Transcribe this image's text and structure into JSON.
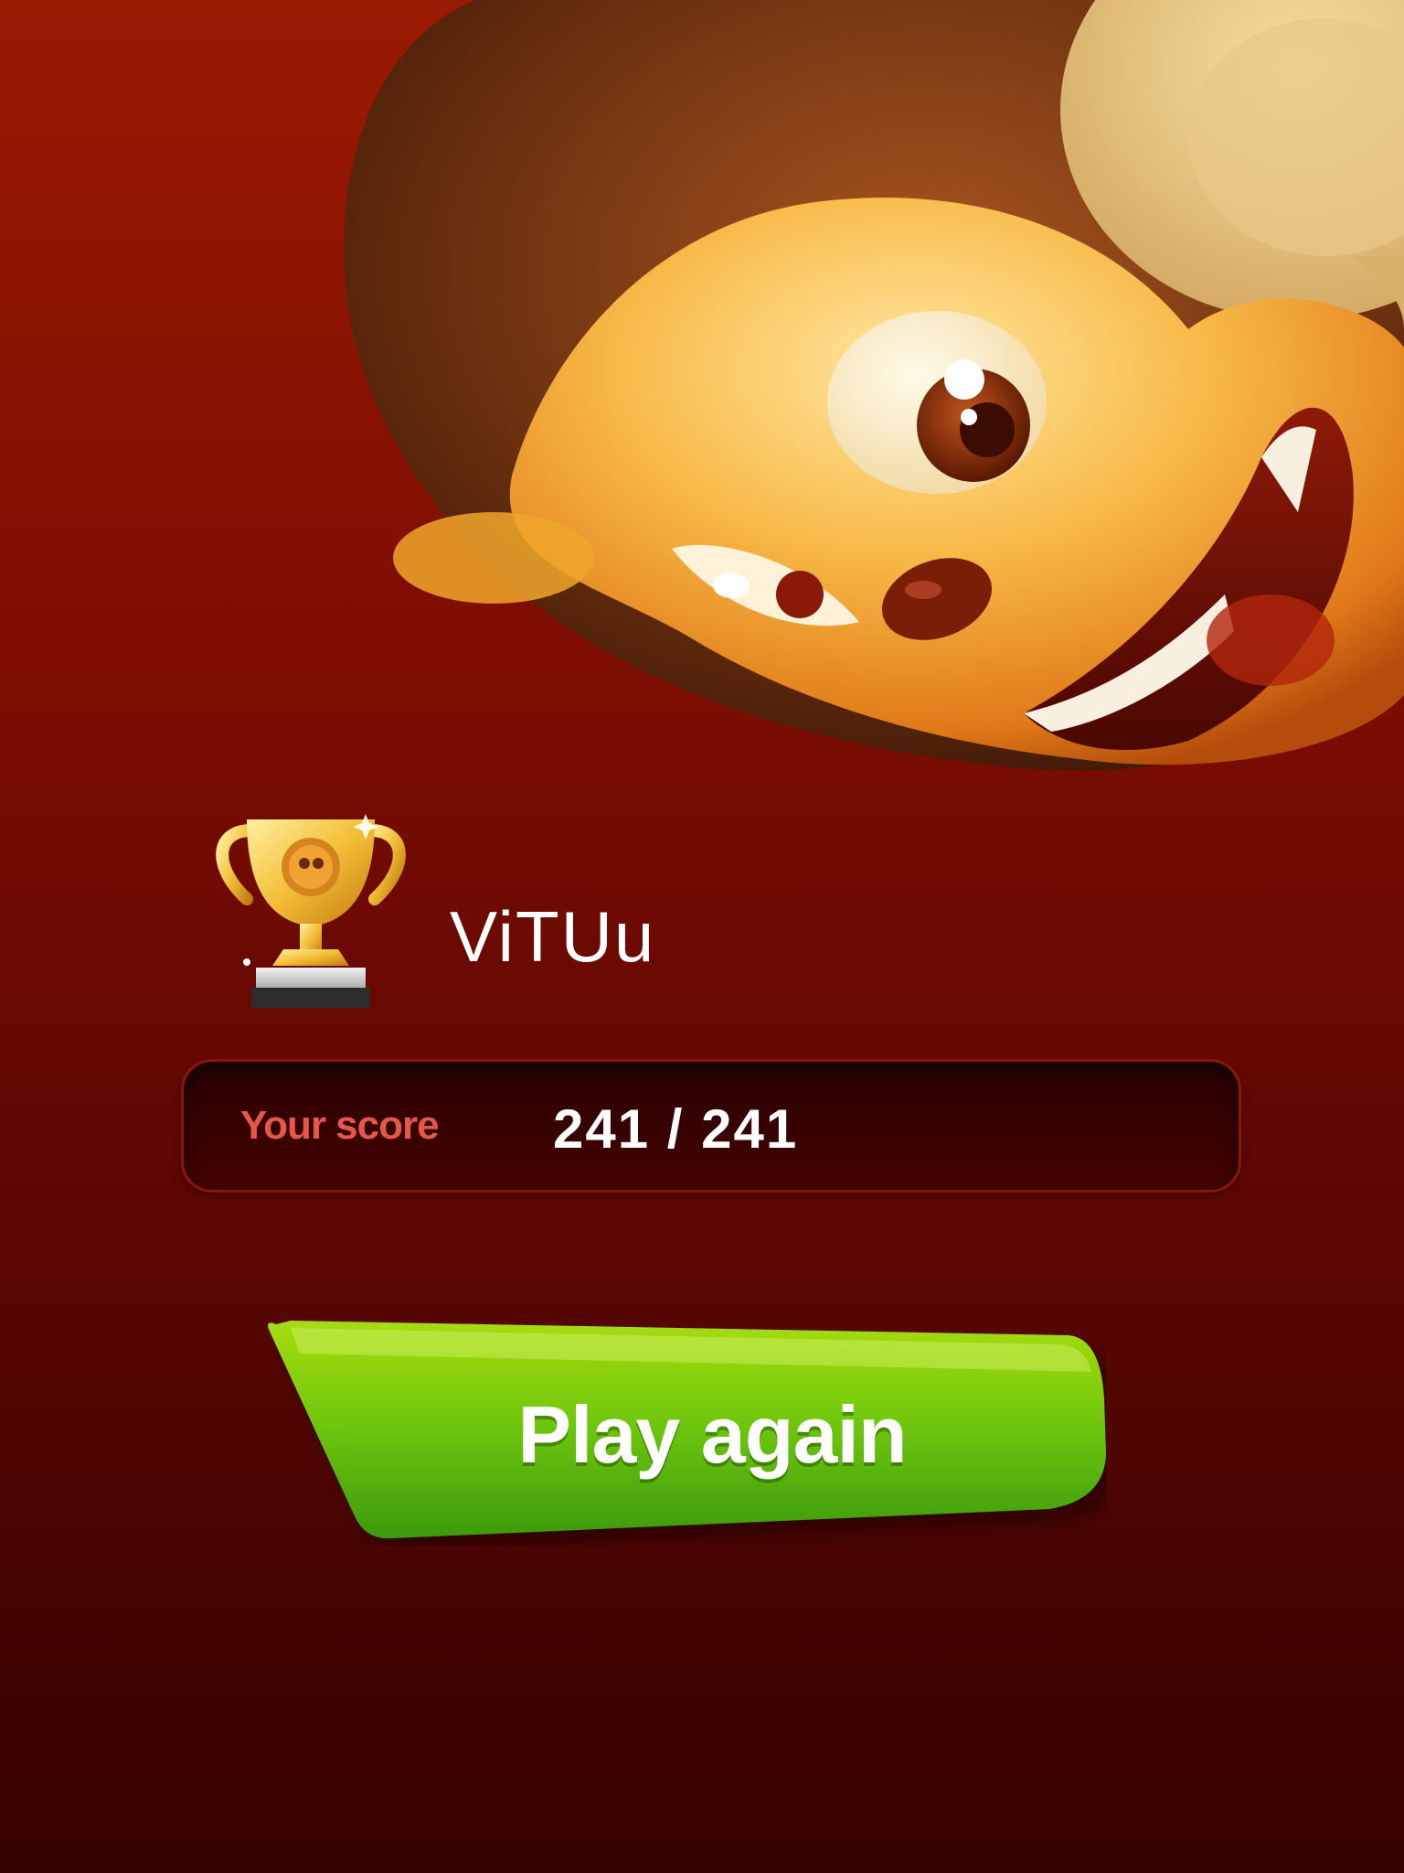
{
  "player": {
    "name": "ViTUu"
  },
  "score": {
    "label": "Your score",
    "value": "241 / 241"
  },
  "actions": {
    "play_again_label": "Play again"
  },
  "icons": {
    "trophy": "trophy-icon",
    "mascot": "monkey-mascot"
  },
  "colors": {
    "background_top": "#9a1a02",
    "background_bottom": "#350101",
    "score_label": "#e4584a",
    "button_green": "#5cc010"
  }
}
